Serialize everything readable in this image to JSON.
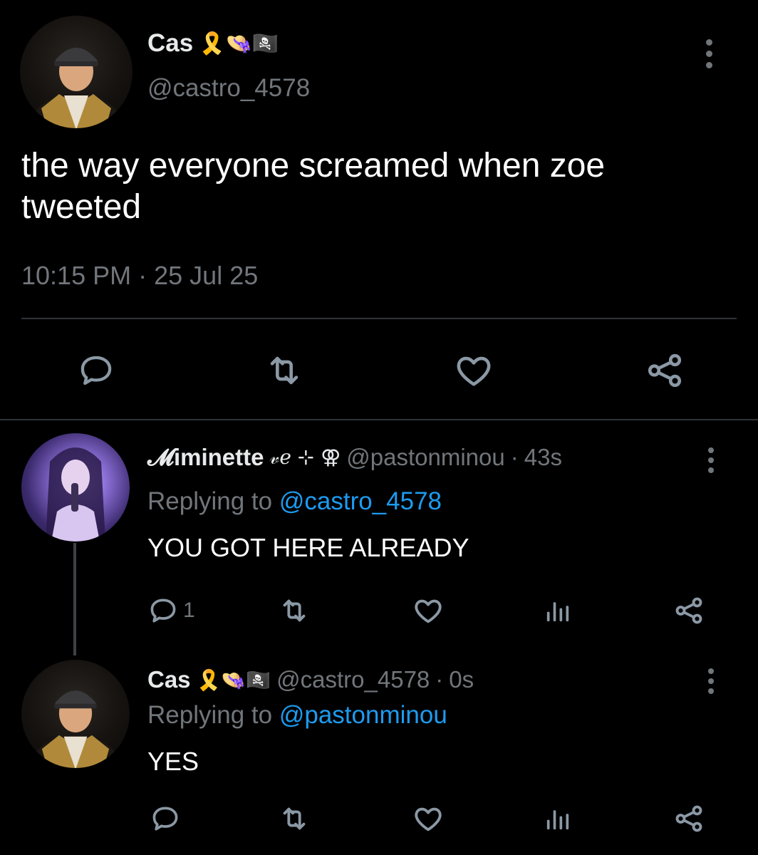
{
  "main_tweet": {
    "display_name": "Cas",
    "name_emojis": "🎗️👒🏴‍☠️",
    "handle": "@castro_4578",
    "text": "the way everyone screamed when zoe tweeted",
    "time": "10:15 PM",
    "separator": "·",
    "date": "25 Jul 25"
  },
  "replies": [
    {
      "display_name": "𝓜iminette",
      "name_symbols": "𝓋ℯ ⊹ ⚢",
      "handle": "@pastonminou",
      "separator": "·",
      "age": "43s",
      "replying_label": "Replying to",
      "replying_to": "@castro_4578",
      "text": "YOU GOT HERE ALREADY",
      "reply_count": "1"
    },
    {
      "display_name": "Cas",
      "name_emojis": "🎗️👒🏴‍☠️",
      "handle": "@castro_4578",
      "separator": "·",
      "age": "0s",
      "replying_label": "Replying to",
      "replying_to": "@pastonminou",
      "text": "YES",
      "reply_count": ""
    }
  ],
  "icons": [
    "reply-icon",
    "retweet-icon",
    "like-icon",
    "share-icon",
    "views-icon",
    "more-icon"
  ],
  "colors": {
    "background": "#000000",
    "text": "#e7e9ea",
    "muted": "#71767b",
    "link": "#1d9bf0",
    "divider": "#2f3336"
  }
}
